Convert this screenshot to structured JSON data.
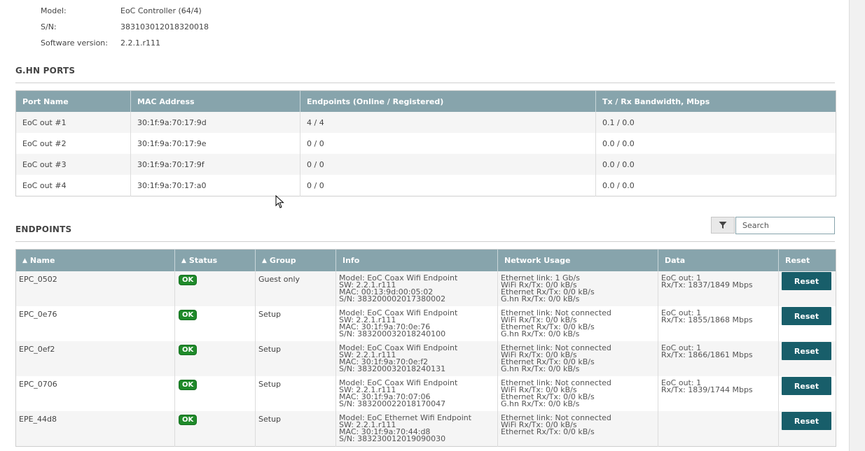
{
  "device": [
    {
      "label": "Model:",
      "value": "EoC Controller (64/4)"
    },
    {
      "label": "S/N:",
      "value": "383103012018320018"
    },
    {
      "label": "Software version:",
      "value": "2.2.1.r111"
    }
  ],
  "ports": {
    "title": "G.HN PORTS",
    "headers": [
      "Port Name",
      "MAC Address",
      "Endpoints (Online / Registered)",
      "Tx / Rx Bandwidth, Mbps"
    ],
    "rows": [
      [
        "EoC out #1",
        "30:1f:9a:70:17:9d",
        "4 / 4",
        "0.1 / 0.0"
      ],
      [
        "EoC out #2",
        "30:1f:9a:70:17:9e",
        "0 / 0",
        "0.0 / 0.0"
      ],
      [
        "EoC out #3",
        "30:1f:9a:70:17:9f",
        "0 / 0",
        "0.0 / 0.0"
      ],
      [
        "EoC out #4",
        "30:1f:9a:70:17:a0",
        "0 / 0",
        "0.0 / 0.0"
      ]
    ]
  },
  "endpoints": {
    "title": "ENDPOINTS",
    "search_placeholder": "Search",
    "filter_icon": "filter-icon",
    "headers": {
      "name": "Name",
      "status": "Status",
      "group": "Group",
      "info": "Info",
      "network": "Network Usage",
      "data": "Data",
      "reset": "Reset"
    },
    "rows": [
      {
        "name": "EPC_0502",
        "status": "OK",
        "group": "Guest only",
        "info": [
          "Model: EoC Coax Wifi Endpoint",
          "SW: 2.2.1.r111",
          "MAC: 00:13:9d:00:05:02",
          "S/N: 383200002017380002"
        ],
        "network": [
          "Ethernet link: 1 Gb/s",
          "WiFi Rx/Tx: 0/0 kB/s",
          "Ethernet Rx/Tx: 0/0 kB/s",
          "G.hn Rx/Tx: 0/0 kB/s"
        ],
        "data": [
          "EoC out: 1",
          "Rx/Tx: 1837/1849 Mbps"
        ],
        "reset": "Reset"
      },
      {
        "name": "EPC_0e76",
        "status": "OK",
        "group": "Setup",
        "info": [
          "Model: EoC Coax Wifi Endpoint",
          "SW: 2.2.1.r111",
          "MAC: 30:1f:9a:70:0e:76",
          "S/N: 383200032018240100"
        ],
        "network": [
          "Ethernet link: Not connected",
          "WiFi Rx/Tx: 0/0 kB/s",
          "Ethernet Rx/Tx: 0/0 kB/s",
          "G.hn Rx/Tx: 0/0 kB/s"
        ],
        "data": [
          "EoC out: 1",
          "Rx/Tx: 1855/1868 Mbps"
        ],
        "reset": "Reset"
      },
      {
        "name": "EPC_0ef2",
        "status": "OK",
        "group": "Setup",
        "info": [
          "Model: EoC Coax Wifi Endpoint",
          "SW: 2.2.1.r111",
          "MAC: 30:1f:9a:70:0e:f2",
          "S/N: 383200032018240131"
        ],
        "network": [
          "Ethernet link: Not connected",
          "WiFi Rx/Tx: 0/0 kB/s",
          "Ethernet Rx/Tx: 0/0 kB/s",
          "G.hn Rx/Tx: 0/0 kB/s"
        ],
        "data": [
          "EoC out: 1",
          "Rx/Tx: 1866/1861 Mbps"
        ],
        "reset": "Reset"
      },
      {
        "name": "EPC_0706",
        "status": "OK",
        "group": "Setup",
        "info": [
          "Model: EoC Coax Wifi Endpoint",
          "SW: 2.2.1.r111",
          "MAC: 30:1f:9a:70:07:06",
          "S/N: 383200022018170047"
        ],
        "network": [
          "Ethernet link: Not connected",
          "WiFi Rx/Tx: 0/0 kB/s",
          "Ethernet Rx/Tx: 0/0 kB/s",
          "G.hn Rx/Tx: 0/0 kB/s"
        ],
        "data": [
          "EoC out: 1",
          "Rx/Tx: 1839/1744 Mbps"
        ],
        "reset": "Reset"
      },
      {
        "name": "EPE_44d8",
        "status": "OK",
        "group": "Setup",
        "info": [
          "Model: EoC Ethernet Wifi Endpoint",
          "SW: 2.2.1.r111",
          "MAC: 30:1f:9a:70:44:d8",
          "S/N: 383230012019090030"
        ],
        "network": [
          "Ethernet link: Not connected",
          "WiFi Rx/Tx: 0/0 kB/s",
          "Ethernet Rx/Tx: 0/0 kB/s"
        ],
        "data": [],
        "reset": "Reset"
      }
    ]
  },
  "colors": {
    "header_bg": "#87a4ac",
    "ok_badge": "#1f8a2a",
    "reset_button": "#185e6a"
  }
}
